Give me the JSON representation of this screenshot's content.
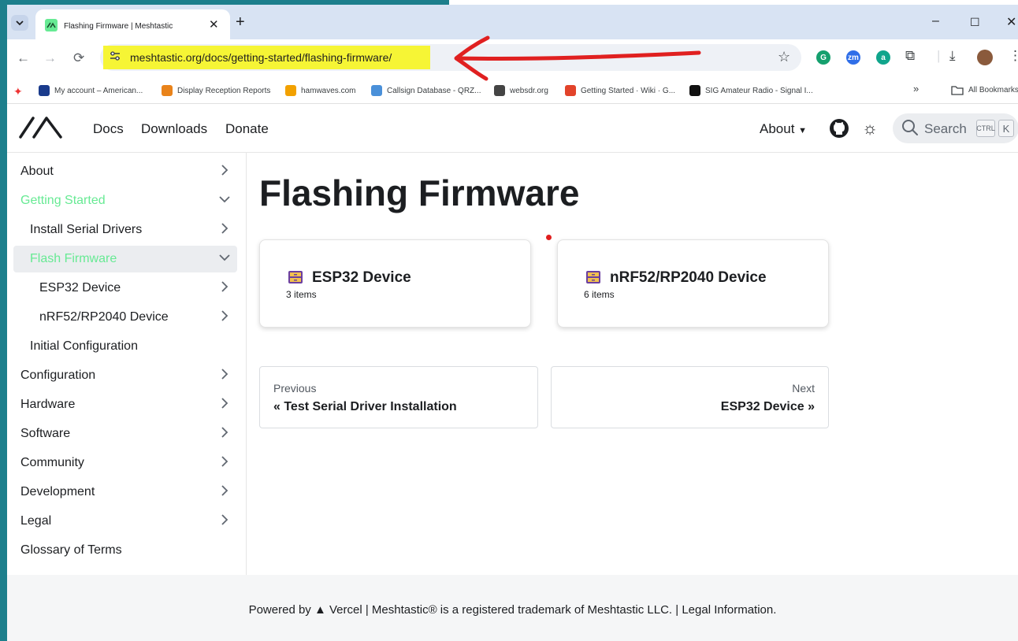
{
  "browser": {
    "tab_title": "Flashing Firmware | Meshtastic",
    "url": "meshtastic.org/docs/getting-started/flashing-firmware/",
    "extensions": [
      {
        "icon": "grammarly-icon",
        "letter": "G",
        "color": "#15a06e"
      },
      {
        "icon": "zoom-icon",
        "letter": "zm",
        "color": "#2f6ee8"
      },
      {
        "icon": "a-extension-icon",
        "letter": "a",
        "color": "#10a58c"
      }
    ],
    "bookmarks": [
      {
        "label": "My account – American...",
        "color": "#1a3b8c"
      },
      {
        "label": "Display Reception Reports",
        "color": "#e9831a"
      },
      {
        "label": "hamwaves.com",
        "color": "#f2a100"
      },
      {
        "label": "Callsign Database - QRZ...",
        "color": "#4a90d9"
      },
      {
        "label": "websdr.org",
        "color": "#444444"
      },
      {
        "label": "Getting Started · Wiki · G...",
        "color": "#e2432a"
      },
      {
        "label": "SIG Amateur Radio - Signal I...",
        "color": "#111111"
      }
    ],
    "bookmarks_more": "»",
    "all_bookmarks": "All Bookmarks"
  },
  "site": {
    "nav": {
      "docs": "Docs",
      "downloads": "Downloads",
      "donate": "Donate",
      "about": "About"
    },
    "search": {
      "label": "Search",
      "kbd_ctrl": "CTRL",
      "kbd_k": "K"
    },
    "accent": "#67ea94"
  },
  "sidebar": {
    "items": [
      {
        "label": "About"
      },
      {
        "label": "Getting Started"
      },
      {
        "label": "Install Serial Drivers"
      },
      {
        "label": "Flash Firmware"
      },
      {
        "label": "ESP32 Device"
      },
      {
        "label": "nRF52/RP2040 Device"
      },
      {
        "label": "Initial Configuration"
      },
      {
        "label": "Configuration"
      },
      {
        "label": "Hardware"
      },
      {
        "label": "Software"
      },
      {
        "label": "Community"
      },
      {
        "label": "Development"
      },
      {
        "label": "Legal"
      },
      {
        "label": "Glossary of Terms"
      }
    ]
  },
  "main": {
    "title": "Flashing Firmware",
    "cards": [
      {
        "title": "ESP32 Device",
        "count": "3 items"
      },
      {
        "title": "nRF52/RP2040 Device",
        "count": "6 items"
      }
    ],
    "pager": {
      "prev_sub": "Previous",
      "prev_label": "« Test Serial Driver Installation",
      "next_sub": "Next",
      "next_label": "ESP32 Device »"
    }
  },
  "footer": {
    "text": "Powered by ▲ Vercel | Meshtastic® is a registered trademark of Meshtastic LLC. | Legal Information."
  }
}
